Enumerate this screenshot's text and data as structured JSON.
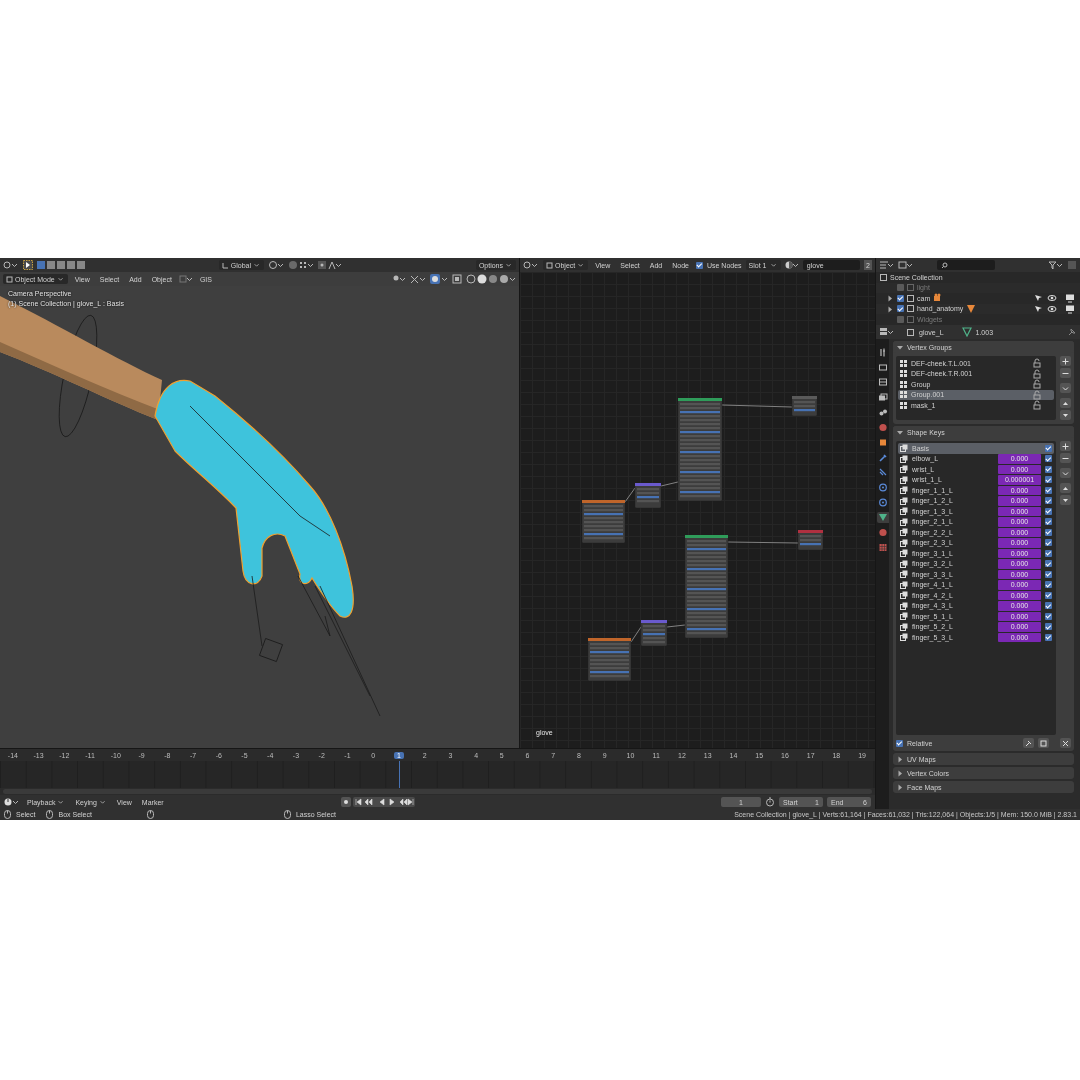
{
  "viewport": {
    "transform_orientation": "Global",
    "options_label": "Options",
    "mode": "Object Mode",
    "menus": [
      "View",
      "Select",
      "Add",
      "Object",
      "GIS"
    ],
    "overlay_text": [
      "Camera Perspective",
      "(1) Scene Collection | glove_L : Basis"
    ]
  },
  "node_editor": {
    "object_type": "Object",
    "menus": [
      "View",
      "Select",
      "Add",
      "Node"
    ],
    "use_nodes": {
      "label": "Use Nodes",
      "checked": true
    },
    "slot": "Slot 1",
    "material": "glove",
    "material_users": "2",
    "material_label": "glove"
  },
  "outliner": {
    "root": "Scene Collection",
    "items": [
      {
        "name": "light",
        "checked": false,
        "expandable": false
      },
      {
        "name": "cam",
        "checked": true,
        "expandable": true
      },
      {
        "name": "hand_anatomy",
        "checked": true,
        "expandable": true
      },
      {
        "name": "Widgets",
        "checked": false,
        "expandable": false
      }
    ]
  },
  "properties": {
    "tabs": [
      {
        "kind": "tool",
        "selected": false
      },
      {
        "kind": "render",
        "selected": false
      },
      {
        "kind": "output",
        "selected": false
      },
      {
        "kind": "view_layer",
        "selected": false
      },
      {
        "kind": "scene",
        "selected": false
      },
      {
        "kind": "world",
        "selected": false
      },
      {
        "kind": "object",
        "selected": false
      },
      {
        "kind": "modifiers",
        "selected": false
      },
      {
        "kind": "particles",
        "selected": false
      },
      {
        "kind": "physics",
        "selected": false
      },
      {
        "kind": "constraints",
        "selected": false
      },
      {
        "kind": "data",
        "selected": true
      },
      {
        "kind": "material",
        "selected": false
      },
      {
        "kind": "texture",
        "selected": false
      }
    ],
    "object_name": "glove_L",
    "mesh_name": "1.003",
    "vertex_groups": {
      "title": "Vertex Groups",
      "expanded": true,
      "items": [
        {
          "name": "DEF-cheek.T.L.001",
          "selected": false
        },
        {
          "name": "DEF-cheek.T.R.001",
          "selected": false
        },
        {
          "name": "Group",
          "selected": false
        },
        {
          "name": "Group.001",
          "selected": true
        },
        {
          "name": "mask_1",
          "selected": false
        }
      ]
    },
    "shape_keys": {
      "title": "Shape Keys",
      "expanded": true,
      "items": [
        {
          "name": "Basis",
          "checked": true,
          "selected": true
        },
        {
          "name": "elbow_L",
          "value": "0.000",
          "checked": true,
          "selected": false
        },
        {
          "name": "wrist_L",
          "value": "0.000",
          "checked": true,
          "selected": false
        },
        {
          "name": "wrist_1_L",
          "value": "0.000001",
          "checked": true,
          "selected": false
        },
        {
          "name": "finger_1_1_L",
          "value": "0.000",
          "checked": true,
          "selected": false
        },
        {
          "name": "finger_1_2_L",
          "value": "0.000",
          "checked": true,
          "selected": false
        },
        {
          "name": "finger_1_3_L",
          "value": "0.000",
          "checked": true,
          "selected": false
        },
        {
          "name": "finger_2_1_L",
          "value": "0.000",
          "checked": true,
          "selected": false
        },
        {
          "name": "finger_2_2_L",
          "value": "0.000",
          "checked": true,
          "selected": false
        },
        {
          "name": "finger_2_3_L",
          "value": "0.000",
          "checked": true,
          "selected": false
        },
        {
          "name": "finger_3_1_L",
          "value": "0.000",
          "checked": true,
          "selected": false
        },
        {
          "name": "finger_3_2_L",
          "value": "0.000",
          "checked": true,
          "selected": false
        },
        {
          "name": "finger_3_3_L",
          "value": "0.000",
          "checked": true,
          "selected": false
        },
        {
          "name": "finger_4_1_L",
          "value": "0.000",
          "checked": true,
          "selected": false
        },
        {
          "name": "finger_4_2_L",
          "value": "0.000",
          "checked": true,
          "selected": false
        },
        {
          "name": "finger_4_3_L",
          "value": "0.000",
          "checked": true,
          "selected": false
        },
        {
          "name": "finger_5_1_L",
          "value": "0.000",
          "checked": true,
          "selected": false
        },
        {
          "name": "finger_5_2_L",
          "value": "0.000",
          "checked": true,
          "selected": false
        },
        {
          "name": "finger_5_3_L",
          "value": "0.000",
          "checked": true,
          "selected": false
        }
      ],
      "relative": {
        "label": "Relative",
        "checked": true
      }
    },
    "collapsed_panels": [
      {
        "title": "UV Maps",
        "expanded": false
      },
      {
        "title": "Vertex Colors",
        "expanded": false
      },
      {
        "title": "Face Maps",
        "expanded": false
      }
    ]
  },
  "timeline": {
    "frames": [
      {
        "label": "-14",
        "selected": false
      },
      {
        "label": "-13",
        "selected": false
      },
      {
        "label": "-12",
        "selected": false
      },
      {
        "label": "-11",
        "selected": false
      },
      {
        "label": "-10",
        "selected": false
      },
      {
        "label": "-9",
        "selected": false
      },
      {
        "label": "-8",
        "selected": false
      },
      {
        "label": "-7",
        "selected": false
      },
      {
        "label": "-6",
        "selected": false
      },
      {
        "label": "-5",
        "selected": false
      },
      {
        "label": "-4",
        "selected": false
      },
      {
        "label": "-3",
        "selected": false
      },
      {
        "label": "-2",
        "selected": false
      },
      {
        "label": "-1",
        "selected": false
      },
      {
        "label": "0",
        "selected": false
      },
      {
        "label": "1",
        "selected": true
      },
      {
        "label": "2",
        "selected": false
      },
      {
        "label": "3",
        "selected": false
      },
      {
        "label": "4",
        "selected": false
      },
      {
        "label": "5",
        "selected": false
      },
      {
        "label": "6",
        "selected": false
      },
      {
        "label": "7",
        "selected": false
      },
      {
        "label": "8",
        "selected": false
      },
      {
        "label": "9",
        "selected": false
      },
      {
        "label": "10",
        "selected": false
      },
      {
        "label": "11",
        "selected": false
      },
      {
        "label": "12",
        "selected": false
      },
      {
        "label": "13",
        "selected": false
      },
      {
        "label": "14",
        "selected": false
      },
      {
        "label": "15",
        "selected": false
      },
      {
        "label": "16",
        "selected": false
      },
      {
        "label": "17",
        "selected": false
      },
      {
        "label": "18",
        "selected": false
      },
      {
        "label": "19",
        "selected": false
      }
    ],
    "menus": [
      "Playback",
      "Keying",
      "View",
      "Marker"
    ],
    "current_frame": "1",
    "start": {
      "label": "Start",
      "value": "1"
    },
    "end": {
      "label": "End",
      "value": "6"
    }
  },
  "status_bar": {
    "actions": [
      "Select",
      "Box Select",
      "Lasso Select"
    ],
    "stats": "Scene Collection | glove_L | Verts:61,164 | Faces:61,032 | Tris:122,064 | Objects:1/5 | Mem: 150.0 MiB | 2.83.1"
  }
}
